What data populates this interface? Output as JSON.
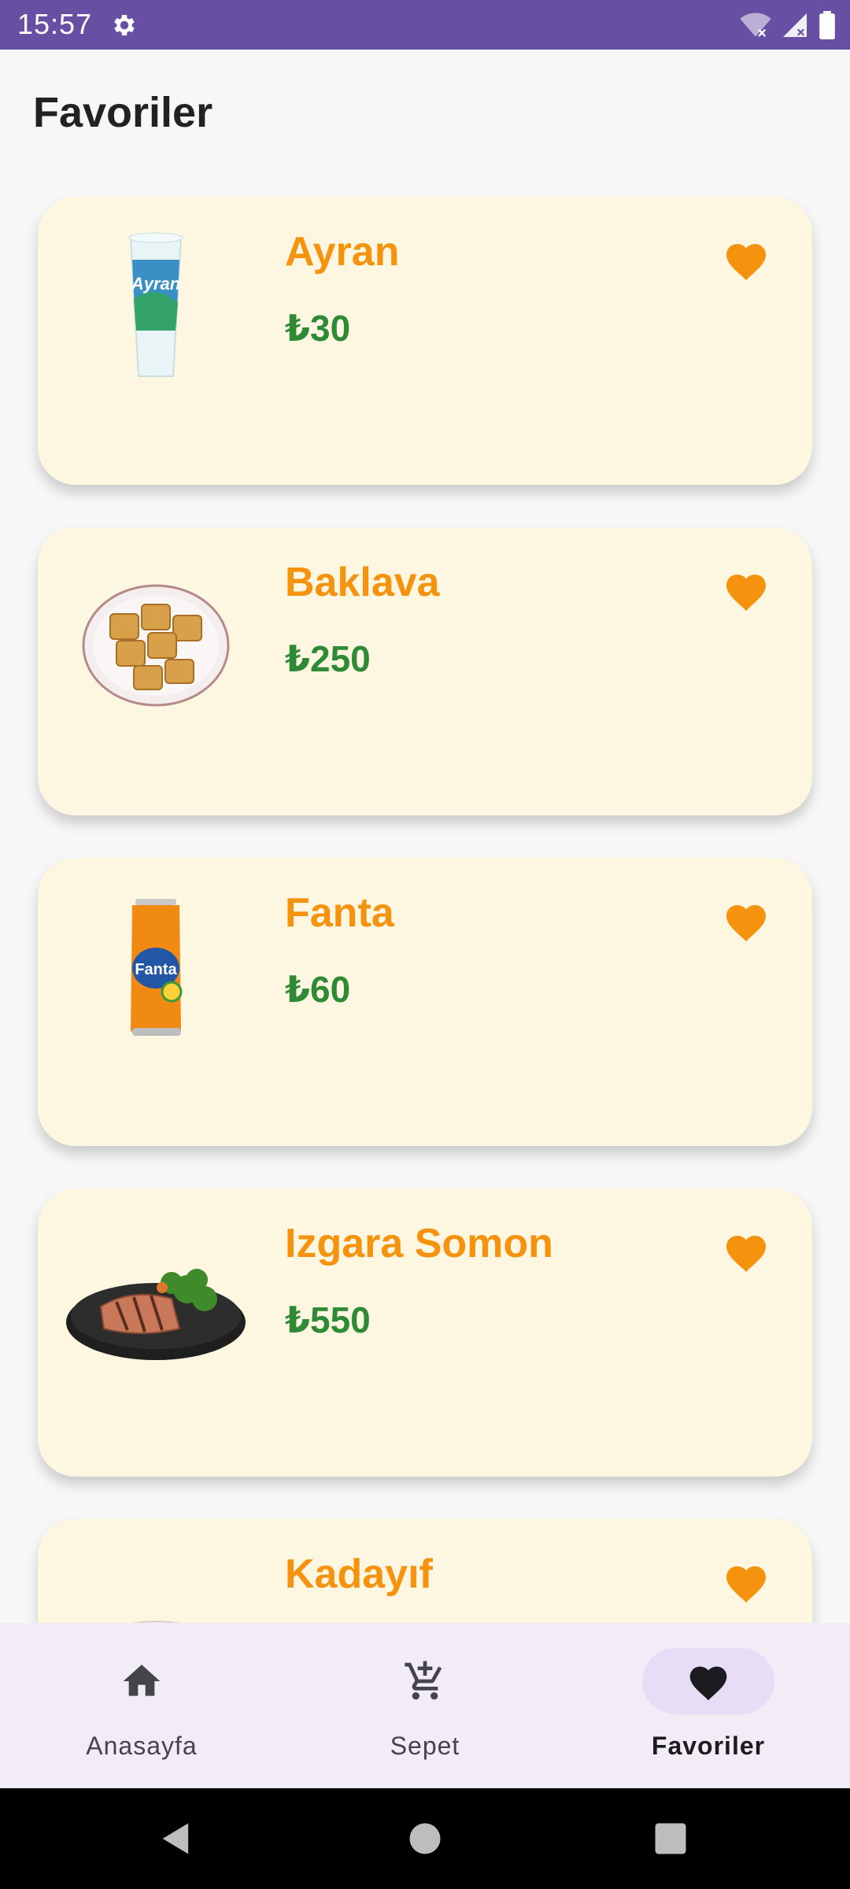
{
  "status_bar": {
    "time": "15:57",
    "icons": [
      "gear-icon",
      "wifi-off-icon",
      "signal-icon",
      "battery-icon"
    ]
  },
  "page": {
    "title": "Favoriler"
  },
  "favorites": [
    {
      "name": "Ayran",
      "price": "₺30",
      "image": "ayran-cup",
      "favorite_icon": "heart-filled-icon"
    },
    {
      "name": "Baklava",
      "price": "₺250",
      "image": "baklava-plate",
      "favorite_icon": "heart-filled-icon"
    },
    {
      "name": "Fanta",
      "price": "₺60",
      "image": "fanta-can",
      "favorite_icon": "heart-filled-icon"
    },
    {
      "name": "Izgara Somon",
      "price": "₺550",
      "image": "grilled-salmon-plate",
      "favorite_icon": "heart-filled-icon"
    },
    {
      "name": "Kadayıf",
      "price": "",
      "image": "kadayif-plate",
      "favorite_icon": "heart-filled-icon"
    }
  ],
  "bottom_nav": {
    "items": [
      {
        "label": "Anasayfa",
        "icon": "home-icon",
        "active": false
      },
      {
        "label": "Sepet",
        "icon": "add-to-cart-icon",
        "active": false
      },
      {
        "label": "Favoriler",
        "icon": "heart-icon",
        "active": true
      }
    ]
  },
  "colors": {
    "status_bar": "#6750a4",
    "card_background": "#fdf7e1",
    "product_name": "#f5930f",
    "price": "#2f8a35",
    "favorite_heart": "#f5930f",
    "nav_background": "#f2ecf6",
    "nav_active_pill": "#e8ddf7"
  }
}
